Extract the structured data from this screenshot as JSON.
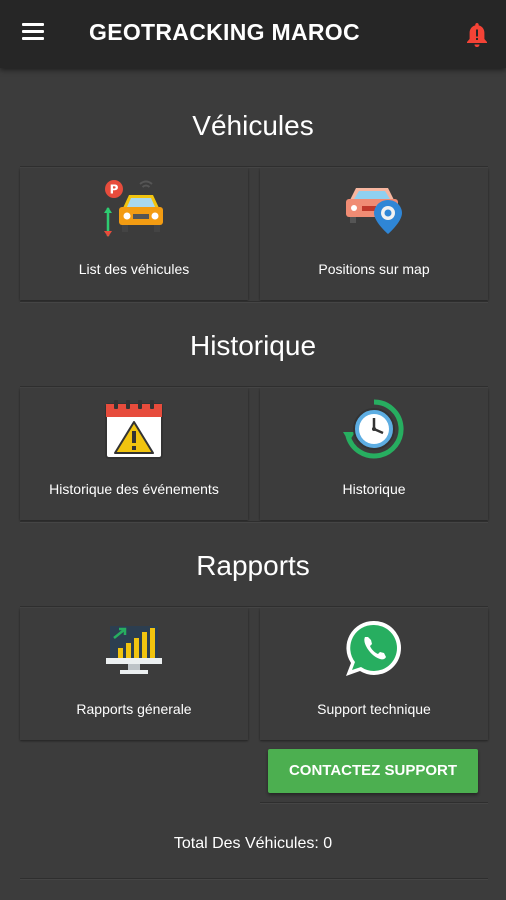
{
  "app_bar": {
    "title": "GEOTRACKING MAROC",
    "menu_icon": "hamburger-menu-icon",
    "notification_icon": "notification-bell-icon",
    "notification_color": "#f44336"
  },
  "sections": {
    "vehicules": {
      "title": "Véhicules",
      "cards": [
        {
          "label": "List des véhicules",
          "icon": "car-parking-icon"
        },
        {
          "label": "Positions sur map",
          "icon": "car-location-pin-icon"
        }
      ]
    },
    "historique": {
      "title": "Historique",
      "cards": [
        {
          "label": "Historique des événements",
          "icon": "calendar-warning-icon"
        },
        {
          "label": "Historique",
          "icon": "clock-history-icon"
        }
      ]
    },
    "rapports": {
      "title": "Rapports",
      "cards": [
        {
          "label": "Rapports génerale",
          "icon": "bar-chart-monitor-icon"
        },
        {
          "label": "Support technique",
          "icon": "whatsapp-icon"
        }
      ]
    }
  },
  "support_button": {
    "label": "CONTACTEZ SUPPORT",
    "color": "#4caf50"
  },
  "total_vehicules": "Total Des Véhicules: 0"
}
